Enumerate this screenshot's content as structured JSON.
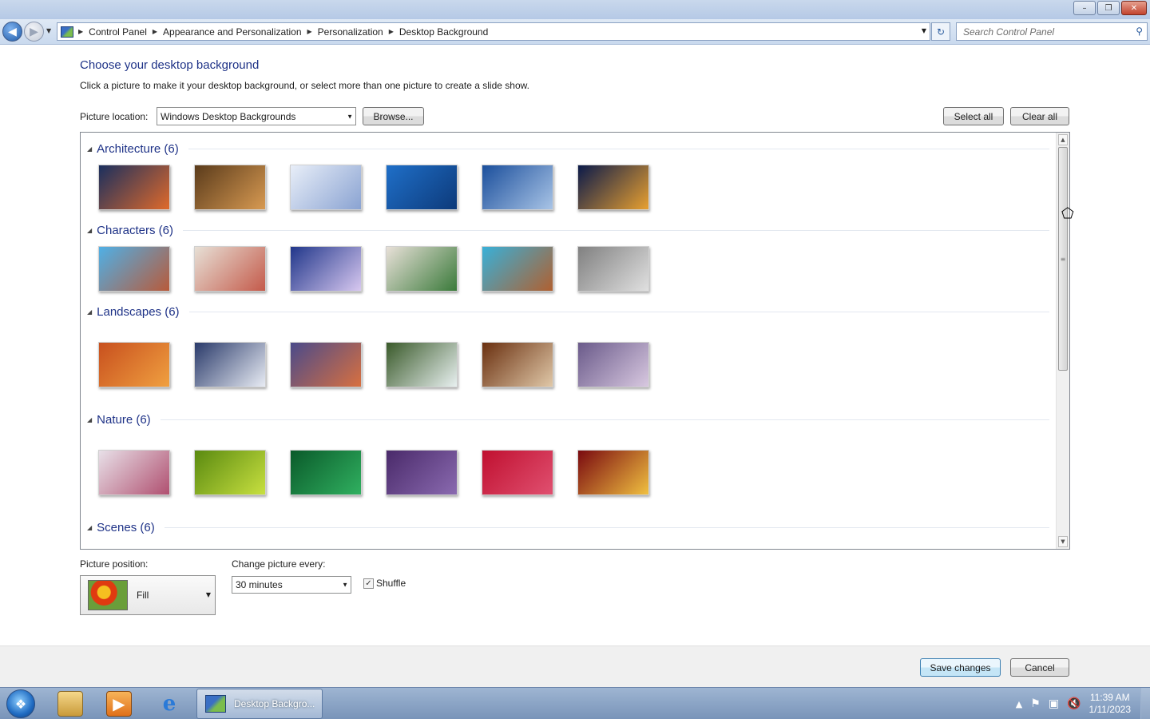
{
  "window": {
    "minimize": "–",
    "restore": "❐",
    "close": "✕"
  },
  "address": {
    "crumbs": [
      "Control Panel",
      "Appearance and Personalization",
      "Personalization",
      "Desktop Background"
    ],
    "search_placeholder": "Search Control Panel"
  },
  "main": {
    "heading": "Choose your desktop background",
    "subtext": "Click a picture to make it your desktop background, or select more than one picture to create a slide show.",
    "location_label": "Picture location:",
    "location_value": "Windows Desktop Backgrounds",
    "browse_label": "Browse...",
    "select_all_label": "Select all",
    "clear_all_label": "Clear all"
  },
  "groups": [
    {
      "title": "Architecture (6)",
      "colors": [
        [
          "#1a2f5e",
          "#e06a2b"
        ],
        [
          "#5a3b1b",
          "#d89a52"
        ],
        [
          "#e8eef8",
          "#8aa3d2"
        ],
        [
          "#1f6fc8",
          "#0d3a7a"
        ],
        [
          "#1b4f9c",
          "#a9c4e6"
        ],
        [
          "#0b1a4a",
          "#e8a030"
        ]
      ]
    },
    {
      "title": "Characters (6)",
      "colors": [
        [
          "#4fb0e6",
          "#b85a3a"
        ],
        [
          "#e7e0d6",
          "#c45a4a"
        ],
        [
          "#20368a",
          "#d8c8f0"
        ],
        [
          "#e8e0d8",
          "#3a7a3a"
        ],
        [
          "#38b0d8",
          "#b06030"
        ],
        [
          "#808080",
          "#e0e0e0"
        ]
      ]
    },
    {
      "title": "Landscapes (6)",
      "colors": [
        [
          "#c8501e",
          "#f0a040"
        ],
        [
          "#2a3a6a",
          "#e8ecf4"
        ],
        [
          "#4a4a8a",
          "#d87040"
        ],
        [
          "#3a5a2a",
          "#e8f0f0"
        ],
        [
          "#6a3010",
          "#e0c8a8"
        ],
        [
          "#6a5a8a",
          "#d8c8e0"
        ]
      ]
    },
    {
      "title": "Nature (6)",
      "colors": [
        [
          "#e8e0e8",
          "#b05070"
        ],
        [
          "#5a8a10",
          "#c8e040"
        ],
        [
          "#0a5a2a",
          "#30b060"
        ],
        [
          "#4a2a6a",
          "#8a6ab0"
        ],
        [
          "#c01030",
          "#e05070"
        ],
        [
          "#7a0a10",
          "#f0c040"
        ]
      ]
    },
    {
      "title": "Scenes (6)",
      "colors": []
    }
  ],
  "bottom": {
    "position_label": "Picture position:",
    "position_value": "Fill",
    "interval_label": "Change picture every:",
    "interval_value": "30 minutes",
    "shuffle_label": "Shuffle",
    "shuffle_checked": true
  },
  "footer": {
    "save_label": "Save changes",
    "cancel_label": "Cancel"
  },
  "taskbar": {
    "task_title": "Desktop Backgro...",
    "time": "11:39 AM",
    "date": "1/11/2023"
  }
}
